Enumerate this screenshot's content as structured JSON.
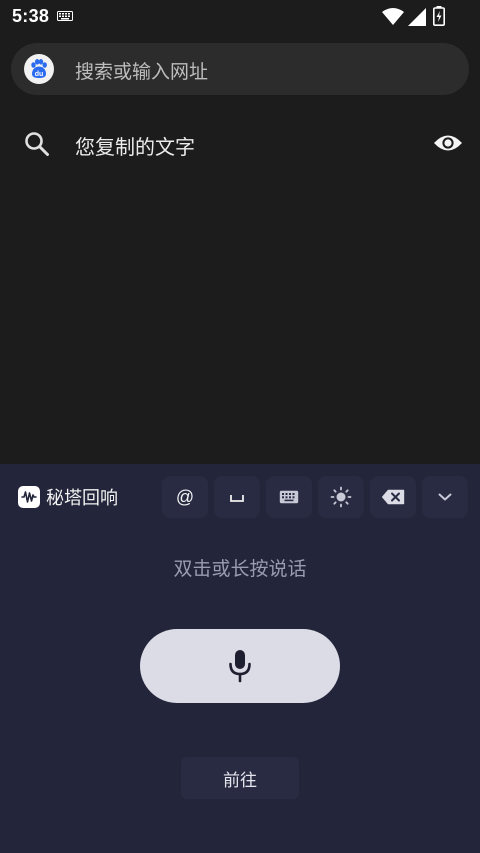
{
  "status_bar": {
    "time": "5:38",
    "icons": [
      "keyboard-icon",
      "wifi-icon",
      "signal-icon",
      "battery-charging-icon"
    ]
  },
  "search_bar": {
    "placeholder": "搜索或输入网址",
    "logo": "baidu-logo"
  },
  "suggestion": {
    "text": "您复制的文字",
    "leading_icon": "search-icon",
    "trailing_icon": "eye-icon"
  },
  "voice_panel": {
    "brand_name": "秘塔回响",
    "toolbar": [
      {
        "name": "at-key",
        "label": "@"
      },
      {
        "name": "space-key",
        "label": "␣"
      },
      {
        "name": "keyboard-toggle",
        "icon": "keyboard-icon"
      },
      {
        "name": "brightness-toggle",
        "icon": "sun-icon"
      },
      {
        "name": "backspace-key",
        "icon": "backspace-icon"
      },
      {
        "name": "collapse-key",
        "icon": "chevron-down-icon"
      }
    ],
    "hint": "双击或长按说话",
    "go_label": "前往"
  },
  "colors": {
    "background": "#1c1c1c",
    "search_bar": "#2c2c2c",
    "panel": "#23253a",
    "toolbar_key": "#282b42",
    "mic_button": "#dcdce6",
    "baidu_blue": "#2a6bf0"
  }
}
